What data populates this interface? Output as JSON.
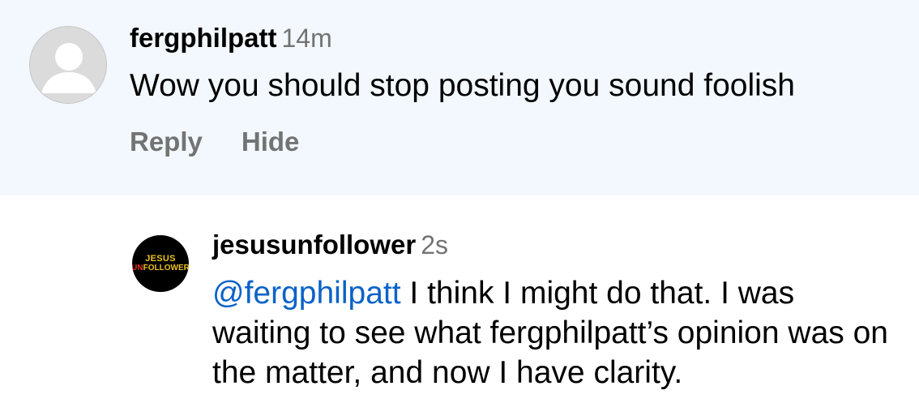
{
  "comment": {
    "username": "fergphilpatt",
    "time": "14m",
    "text": "Wow you should stop posting you sound foolish",
    "reply_label": "Reply",
    "hide_label": "Hide",
    "background_color": "#f2f8fd"
  },
  "reply": {
    "username": "jesusunfollower",
    "time": "2s",
    "avatar_line1": "JESUS",
    "avatar_line2_a": "UN",
    "avatar_line2_b": "FOLLOWER",
    "mention": "@fergphilpatt",
    "text": " I think I might do that. I was waiting to see what fergphilpatt’s opinion was on the matter, and now I have clarity.",
    "mention_color": "#0a62c8"
  }
}
